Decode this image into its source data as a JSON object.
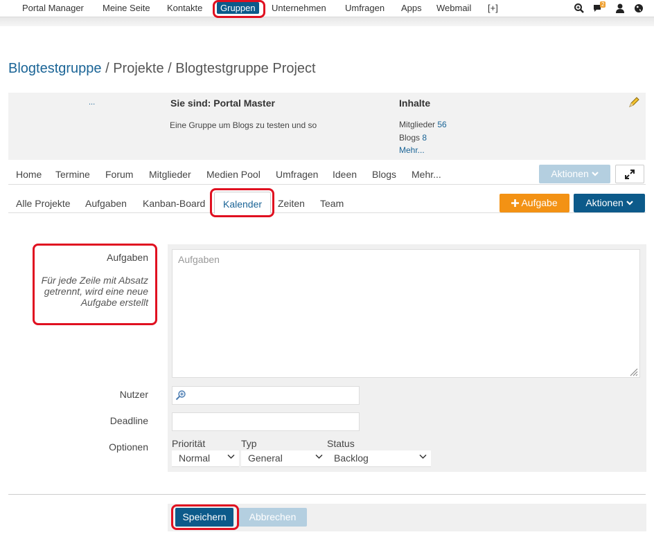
{
  "topnav": {
    "items": [
      "Portal Manager",
      "Meine Seite",
      "Kontakte",
      "Gruppen",
      "Unternehmen",
      "Umfragen",
      "Apps",
      "Webmail",
      "[+]"
    ],
    "active": "Gruppen",
    "notification_count": "2",
    "icons": [
      "search-icon",
      "chat-icon",
      "user-icon",
      "globe-icon"
    ]
  },
  "breadcrumb": {
    "group": "Blogtestgruppe",
    "sep1": " / ",
    "section": "Projekte",
    "sep2": " / ",
    "project": "Blogtestgruppe Project"
  },
  "info": {
    "dots": "...",
    "role_heading": "Sie sind: Portal Master",
    "description": "Eine Gruppe um Blogs zu testen und so",
    "content_heading": "Inhalte",
    "members_label": "Mitglieder",
    "members_count": "56",
    "blogs_label": "Blogs",
    "blogs_count": "8",
    "more_label": "Mehr..."
  },
  "group_nav": {
    "tabs": [
      "Home",
      "Termine",
      "Forum",
      "Mitglieder",
      "Medien Pool",
      "Umfragen",
      "Ideen",
      "Blogs",
      "Mehr..."
    ],
    "actions_label": "Aktionen"
  },
  "sub_nav": {
    "tabs": [
      "Alle Projekte",
      "Aufgaben",
      "Kanban-Board",
      "Kalender",
      "Zeiten",
      "Team"
    ],
    "active": "Kalender",
    "add_task_label": "Aufgabe",
    "actions_label": "Aktionen"
  },
  "form": {
    "tasks_label": "Aufgaben",
    "tasks_hint": "Für jede Zeile mit Absatz getrennt, wird eine neue Aufgabe erstellt",
    "tasks_placeholder": "Aufgaben",
    "user_label": "Nutzer",
    "deadline_label": "Deadline",
    "options_label": "Optionen",
    "priority_label": "Priorität",
    "priority_value": "Normal",
    "type_label": "Typ",
    "type_value": "General",
    "status_label": "Status",
    "status_value": "Backlog",
    "save_label": "Speichern",
    "cancel_label": "Abbrechen"
  },
  "colors": {
    "primary": "#0c5a8a",
    "link": "#1a6496",
    "orange": "#f39214",
    "highlight": "#e01020"
  }
}
